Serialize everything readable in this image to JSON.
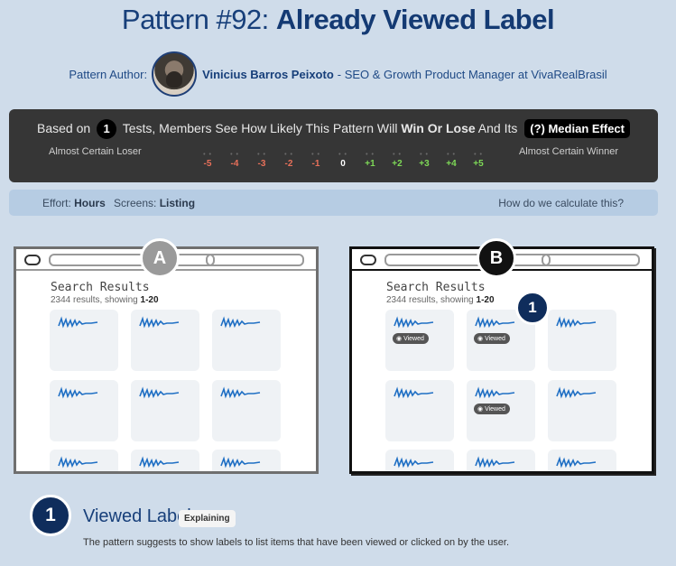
{
  "header": {
    "title_prefix": "Pattern #92:",
    "title_main": "Already Viewed Label"
  },
  "author": {
    "label": "Pattern Author:",
    "name": "Vinicius Barros Peixoto",
    "role": "- SEO & Growth Product Manager at VivaRealBrasil"
  },
  "summary": {
    "based_on": "Based on",
    "tests_count": "1",
    "text_middle": "Tests, Members See How Likely This Pattern Will",
    "win_or_lose": "Win Or Lose",
    "and_its": "And Its",
    "median_effect": "(?) Median Effect",
    "loser_label": "Almost Certain Loser",
    "winner_label": "Almost Certain Winner",
    "scale": [
      "-5",
      "-4",
      "-3",
      "-2",
      "-1",
      "0",
      "+1",
      "+2",
      "+3",
      "+4",
      "+5"
    ],
    "colors": {
      "negative": "#e8705a",
      "neutral": "#ffffff",
      "positive": "#7ed957"
    }
  },
  "effort": {
    "effort_label": "Effort:",
    "effort_value": "Hours",
    "screens_label": "Screens:",
    "screens_value": "Listing",
    "how_calc": "How do we calculate this?"
  },
  "variant_a": {
    "letter": "A",
    "heading": "Search Results",
    "count_prefix": "2344 results, showing",
    "count_range": "1-20"
  },
  "variant_b": {
    "letter": "B",
    "heading": "Search Results",
    "count_prefix": "2344 results, showing",
    "count_range": "1-20",
    "marker": "1",
    "viewed_badge": "Viewed"
  },
  "explain": {
    "number": "1",
    "title": "Viewed Labels",
    "badge": "Explaining",
    "text": "The pattern suggests to show labels to list items that have been viewed or clicked on by the user."
  }
}
